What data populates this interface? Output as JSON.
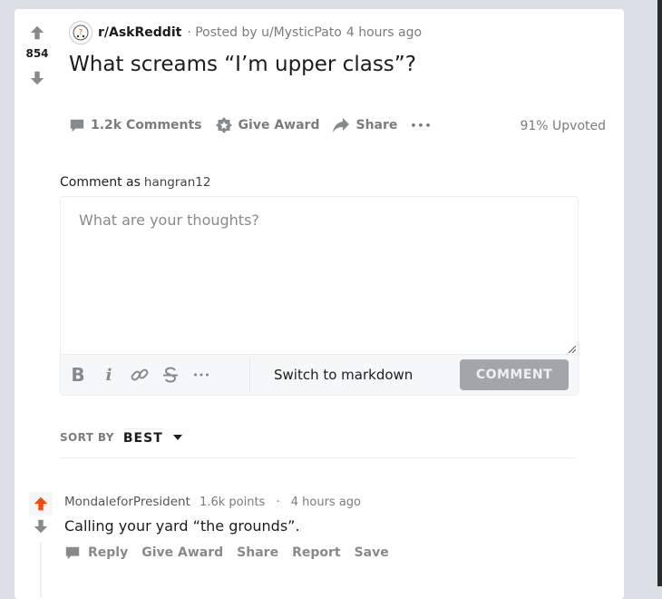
{
  "post": {
    "score": "854",
    "subreddit": "r/AskReddit",
    "posted_by": "· Posted by u/MysticPato",
    "time": "4 hours ago",
    "title": "What screams “I’m upper class”?",
    "actions": {
      "comments": "1.2k Comments",
      "give_award": "Give Award",
      "share": "Share",
      "more": "•••"
    },
    "upvoted": "91% Upvoted"
  },
  "comment_box": {
    "comment_as_label": "Comment as",
    "username": "hangran12",
    "placeholder": "What are your thoughts?",
    "toolbar": {
      "bold": "B",
      "italic": "i",
      "more": "•••",
      "switch_label": "Switch to markdown",
      "submit": "COMMENT"
    }
  },
  "sort": {
    "label": "SORT BY",
    "value": "BEST"
  },
  "comments": [
    {
      "author": "MondaleforPresident",
      "points": "1.6k points",
      "separator": "·",
      "time": "4 hours ago",
      "body": "Calling your yard “the grounds”.",
      "actions": {
        "reply": "Reply",
        "give_award": "Give Award",
        "share": "Share",
        "report": "Report",
        "save": "Save"
      }
    }
  ],
  "colors": {
    "upvote_active": "#ff4500",
    "background": "#dae0e6",
    "muted_text": "#7c7c7c",
    "disabled_button": "#a3a6a9"
  },
  "icons": [
    "upvote-icon",
    "downvote-icon",
    "subreddit-icon",
    "comment-icon",
    "award-icon",
    "share-icon",
    "link-icon",
    "strikethrough-icon",
    "caret-down-icon"
  ]
}
